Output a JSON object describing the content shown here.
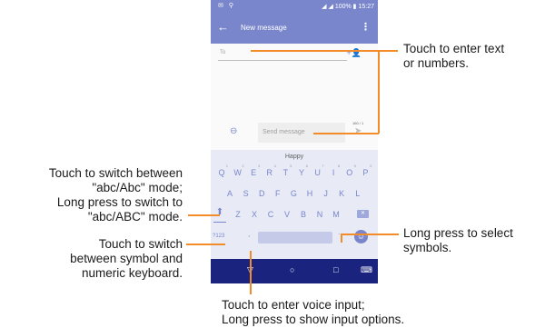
{
  "status_bar": {
    "left_icons": "✉ ⚲",
    "right_text": "◢ ◢ 100% ▮ 15:27"
  },
  "app_bar": {
    "back_icon": "←",
    "title": "New message",
    "menu_icon": "⋮"
  },
  "to_field": {
    "label": "To",
    "add_contact_icon": "+👤"
  },
  "compose": {
    "attach_icon": "⊖",
    "placeholder": "Send message",
    "counter": "160 / 1",
    "send_icon": "➤"
  },
  "keyboard": {
    "suggestion": "Happy",
    "row1": [
      {
        "k": "Q",
        "h": "1"
      },
      {
        "k": "W",
        "h": "2"
      },
      {
        "k": "E",
        "h": "3"
      },
      {
        "k": "R",
        "h": "4"
      },
      {
        "k": "T",
        "h": "5"
      },
      {
        "k": "Y",
        "h": "6"
      },
      {
        "k": "U",
        "h": "7"
      },
      {
        "k": "I",
        "h": "8"
      },
      {
        "k": "O",
        "h": "9"
      },
      {
        "k": "P",
        "h": "0"
      }
    ],
    "row2": [
      "A",
      "S",
      "D",
      "F",
      "G",
      "H",
      "J",
      "K",
      "L"
    ],
    "row3": [
      "Z",
      "X",
      "C",
      "V",
      "B",
      "N",
      "M"
    ],
    "shift_icon": "⬆",
    "backspace_icon": "✕",
    "numeric_key": "?123",
    "comma_key": ",",
    "period_key": ".",
    "emoji_icon": "☺"
  },
  "nav_bar": {
    "back_icon": "▽",
    "home_icon": "○",
    "recents_icon": "□",
    "keyboard_icon": "⌨"
  },
  "callouts": {
    "enter_text": [
      "Touch to enter text",
      "or numbers."
    ],
    "switch_mode": [
      "Touch to switch between",
      "\"abc/Abc\" mode;",
      "Long press to switch to",
      "\"abc/ABC\" mode."
    ],
    "select_symbols": [
      "Long press to select",
      "symbols."
    ],
    "switch_keyboard": [
      "Touch to switch",
      "between symbol and",
      "numeric keyboard."
    ],
    "voice_input": [
      "Touch to enter voice input;",
      "Long press to show input options."
    ]
  },
  "colors": {
    "accent": "#7986cb",
    "nav": "#1a237e",
    "keyboard_bg": "#e8eaf6",
    "callout_line": "#f28c28"
  }
}
